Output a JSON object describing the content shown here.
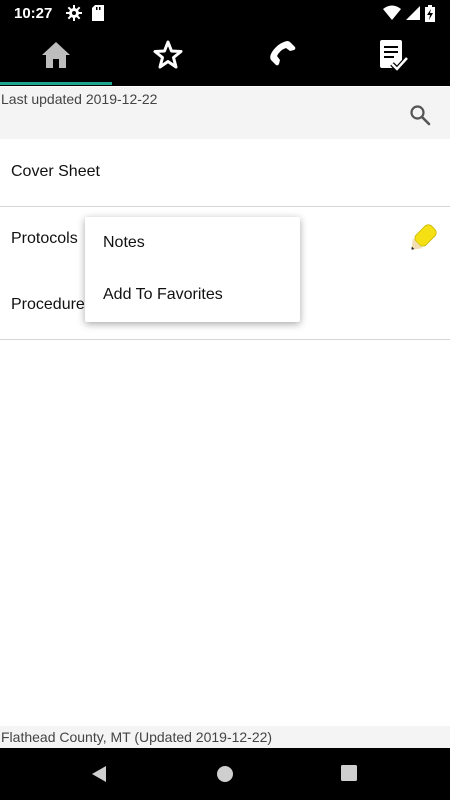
{
  "status_bar": {
    "time": "10:27",
    "icons_left": [
      "settings-icon",
      "sd-card-icon"
    ],
    "icons_right": [
      "wifi-icon",
      "signal-icon",
      "battery-icon"
    ]
  },
  "tabs": [
    {
      "icon": "home-icon",
      "selected": true
    },
    {
      "icon": "star-icon",
      "selected": false
    },
    {
      "icon": "phone-icon",
      "selected": false
    },
    {
      "icon": "checklist-icon",
      "selected": false
    }
  ],
  "header": {
    "last_updated": "Last updated 2019-12-22",
    "search_icon": "search-icon"
  },
  "list": {
    "items": [
      {
        "label": "Cover Sheet"
      },
      {
        "label": "Protocols",
        "badge_icon": "pencil-note-icon"
      },
      {
        "label": "Procedures"
      }
    ]
  },
  "context_menu": {
    "items": [
      {
        "label": "Notes"
      },
      {
        "label": "Add To Favorites"
      }
    ]
  },
  "footer": {
    "text": "Flathead County, MT (Updated 2019-12-22)"
  },
  "nav": {
    "icons": [
      "back-icon",
      "home-circle-icon",
      "recents-icon"
    ]
  },
  "colors": {
    "accent": "#1fa58f",
    "pencil": "#f5e013"
  }
}
